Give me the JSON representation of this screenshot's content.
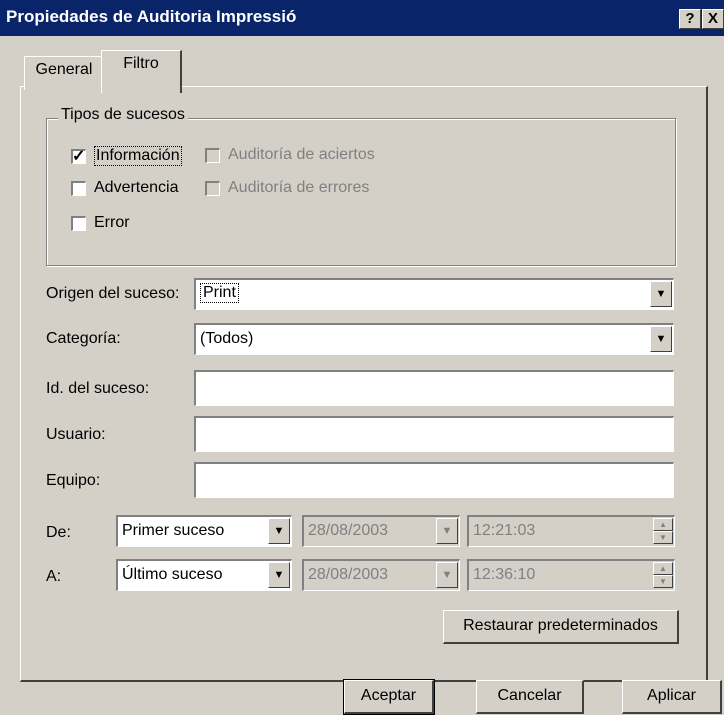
{
  "window": {
    "title": "Propiedades de Auditoria Impressió",
    "help_label": "?",
    "close_label": "X"
  },
  "tabs": [
    {
      "label": "General",
      "selected": false
    },
    {
      "label": "Filtro",
      "selected": true
    }
  ],
  "event_types": {
    "group_label": "Tipos de sucesos",
    "items": [
      {
        "label": "Información",
        "checked": true,
        "enabled": true
      },
      {
        "label": "Advertencia",
        "checked": false,
        "enabled": true
      },
      {
        "label": "Error",
        "checked": false,
        "enabled": true
      },
      {
        "label": "Auditoría de aciertos",
        "checked": false,
        "enabled": false
      },
      {
        "label": "Auditoría de errores",
        "checked": false,
        "enabled": false
      }
    ]
  },
  "fields": {
    "source_label": "Origen del suceso:",
    "source_value": "Print",
    "category_label": "Categoría:",
    "category_value": "(Todos)",
    "event_id_label": "Id. del suceso:",
    "event_id_value": "",
    "user_label": "Usuario:",
    "user_value": "",
    "computer_label": "Equipo:",
    "computer_value": ""
  },
  "range": {
    "from_label": "De:",
    "from_select": "Primer suceso",
    "from_date": "28/08/2003",
    "from_time": "12:21:03",
    "to_label": "A:",
    "to_select": "Último suceso",
    "to_date": "28/08/2003",
    "to_time": "12:36:10"
  },
  "buttons": {
    "restore": "Restaurar predeterminados",
    "accept": "Aceptar",
    "cancel": "Cancelar",
    "apply": "Aplicar"
  },
  "icons": {
    "dropdown": "▼",
    "spin_up": "▲",
    "spin_down": "▼",
    "check": "✓"
  },
  "colors": {
    "titlebar": "#0a246a",
    "face": "#d4d0c8",
    "disabled_text": "#808080"
  }
}
